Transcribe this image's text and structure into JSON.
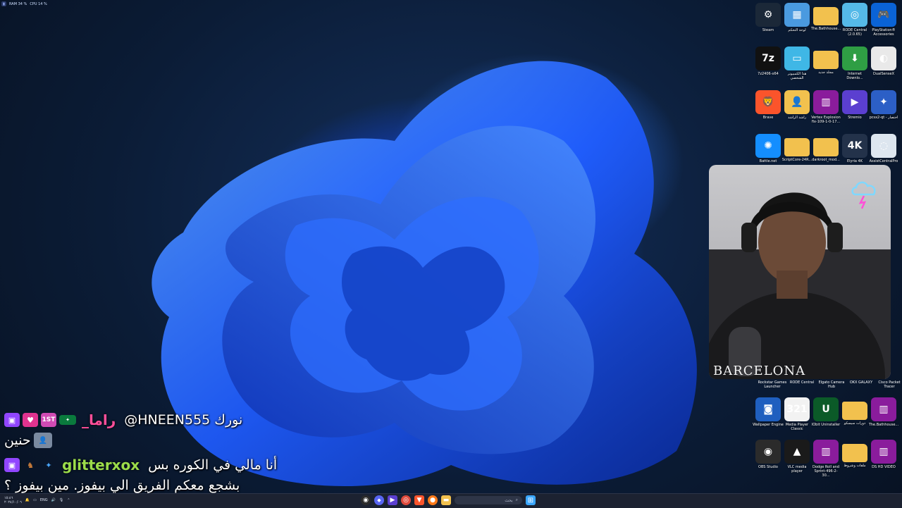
{
  "performance_overlay": {
    "ram": "RAM 34 %",
    "cpu": "CPU 14 %"
  },
  "desktop_icons": [
    {
      "id": "steam",
      "label": "Steam",
      "color": "#1b2838",
      "glyph": "⚙",
      "icon": "steam-icon"
    },
    {
      "id": "control-panel",
      "label": "لوحة التحكم",
      "color": "#4a9ae0",
      "glyph": "▦",
      "icon": "control-panel-icon"
    },
    {
      "id": "bathhouse-1",
      "label": "The.Bathhouse...",
      "color": "#f2c14e",
      "glyph": "",
      "icon": "folder-icon"
    },
    {
      "id": "rode-central",
      "label": "RODE Central (2.0.65)",
      "color": "#55b9e8",
      "glyph": "◎",
      "icon": "disc-icon"
    },
    {
      "id": "ps-accessories",
      "label": "PlayStation® Accessories",
      "color": "#0a63d6",
      "glyph": "🎮",
      "icon": "gamepad-icon"
    },
    {
      "id": "7z",
      "label": "7z2406-x64",
      "color": "#111",
      "glyph": "7z",
      "icon": "archive-icon"
    },
    {
      "id": "this-pc",
      "label": "هذا الكمبيوتر الشخصي",
      "color": "#3fb7e6",
      "glyph": "▭",
      "icon": "monitor-icon"
    },
    {
      "id": "new-folder",
      "label": "مجلد جديد",
      "color": "#f2c14e",
      "glyph": "",
      "icon": "folder-icon"
    },
    {
      "id": "idm",
      "label": "Internet Downlo...",
      "color": "#2f9e44",
      "glyph": "⬇",
      "icon": "download-manager-icon"
    },
    {
      "id": "dualsensex",
      "label": "DualSenseX",
      "color": "#e9e9e9",
      "glyph": "◐",
      "icon": "controller-icon"
    },
    {
      "id": "brave",
      "label": "Brave",
      "color": "#fb542b",
      "glyph": "🦁",
      "icon": "brave-icon"
    },
    {
      "id": "rashid",
      "label": "راشد الراشد",
      "color": "#f2c14e",
      "glyph": "👤",
      "icon": "user-folder-icon"
    },
    {
      "id": "vertex",
      "label": "Vertex Explosion fix-109-1-0-17...",
      "color": "#8a1c9c",
      "glyph": "▥",
      "icon": "winrar-icon"
    },
    {
      "id": "stremio",
      "label": "Stremio",
      "color": "#5b3fd0",
      "glyph": "▶",
      "icon": "play-icon"
    },
    {
      "id": "pcsx2",
      "label": "pcsx2-qt - اختصار",
      "color": "#2c5fc6",
      "glyph": "✦",
      "icon": "pcsx2-icon"
    },
    {
      "id": "battlenet",
      "label": "Battle.net",
      "color": "#148eff",
      "glyph": "✺",
      "icon": "battlenet-icon"
    },
    {
      "id": "scriptcore",
      "label": "ScriptCore-24R...",
      "color": "#f2c14e",
      "glyph": "",
      "icon": "folder-icon"
    },
    {
      "id": "darkroot",
      "label": "darkroot_mod...",
      "color": "#f2c14e",
      "glyph": "",
      "icon": "folder-icon"
    },
    {
      "id": "4k",
      "label": "Elyria 4K",
      "color": "#23324a",
      "glyph": "4K",
      "icon": "4k-video-icon"
    },
    {
      "id": "assist",
      "label": "AssistCentralPro",
      "color": "#dde6ef",
      "glyph": "◌",
      "icon": "assist-icon"
    }
  ],
  "desktop_icons_bottom": [
    {
      "id": "wallpaper-engine",
      "label": "Wallpaper Engine",
      "color": "#1f5fbf",
      "glyph": "◙",
      "icon": "wallpaper-engine-icon"
    },
    {
      "id": "mpc",
      "label": "Media Player Classic",
      "color": "#f2f2f2",
      "glyph": "321",
      "icon": "media-player-icon"
    },
    {
      "id": "iobit",
      "label": "IObit Uninstaller",
      "color": "#0b5a28",
      "glyph": "U",
      "icon": "uninstaller-icon"
    },
    {
      "id": "dawrat",
      "label": "دورات سيسكو",
      "color": "#f2c14e",
      "glyph": "",
      "icon": "folder-icon"
    },
    {
      "id": "bathhouse-2",
      "label": "The.Bathhouse...",
      "color": "#8a1c9c",
      "glyph": "▥",
      "icon": "winrar-icon"
    },
    {
      "id": "obs",
      "label": "OBS Studio",
      "color": "#2b2b2b",
      "glyph": "◉",
      "icon": "obs-icon"
    },
    {
      "id": "vlc",
      "label": "VLC media player",
      "color": "#1a1a1a",
      "glyph": "▲",
      "icon": "vlc-icon"
    },
    {
      "id": "dodge",
      "label": "Dodge Roll and Sprint-496-2-30...",
      "color": "#8a1c9c",
      "glyph": "▥",
      "icon": "winrar-icon"
    },
    {
      "id": "files",
      "label": "ملفات وشروط",
      "color": "#f2c14e",
      "glyph": "",
      "icon": "folder-icon"
    },
    {
      "id": "ds-hd",
      "label": "DS HD VIDEO",
      "color": "#8a1c9c",
      "glyph": "▥",
      "icon": "winrar-icon"
    }
  ],
  "partial_icon_labels": [
    "Rockstar Games Launcher",
    "RODE Central",
    "Elgato Camera Hub",
    "OKX GALAXY",
    "Cisco Packet Tracer"
  ],
  "webcam": {
    "jersey_text": "BARCELONA"
  },
  "chat": [
    {
      "badges": [
        "twitch",
        "heart",
        "1st",
        "flag-sa"
      ],
      "username": "_راما",
      "username_color": "#ff4f9a",
      "message": "@HNEEN555 نورك"
    },
    {
      "badges": [
        "avatar"
      ],
      "username": "",
      "username_color": "#ffffff",
      "message": "حنين"
    },
    {
      "badges": [
        "twitch",
        "figure",
        "star"
      ],
      "username": "glitterxox",
      "username_color": "#9bdc4a",
      "message": "أنا مالي في الكوره بس"
    },
    {
      "badges": [],
      "username": "",
      "username_color": "#ffffff",
      "message": "بشجع معكم الفريق الي بيفوز. مين بيفوز ؟"
    }
  ],
  "taskbar": {
    "search_placeholder": "بحث",
    "lang": "ENG",
    "time": "١٥:٤٦",
    "date": "٢٠٢٤/١٠/٠٦"
  }
}
